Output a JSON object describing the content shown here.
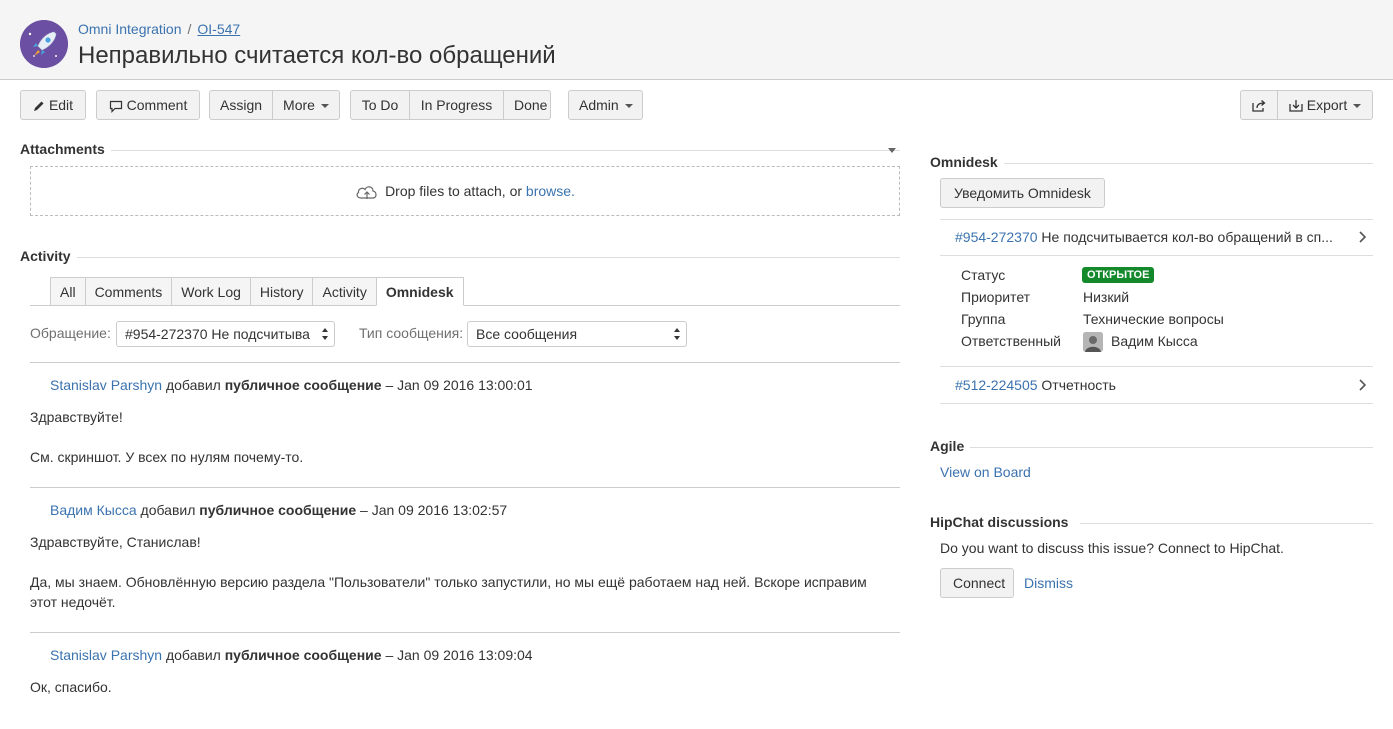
{
  "header": {
    "project": "Omni Integration",
    "separator": "/",
    "issue_key": "OI-547",
    "title": "Неправильно считается кол-во обращений"
  },
  "toolbar": {
    "edit": "Edit",
    "comment": "Comment",
    "assign": "Assign",
    "more": "More",
    "todo": "To Do",
    "in_progress": "In Progress",
    "done": "Done",
    "admin": "Admin",
    "export": "Export"
  },
  "attachments": {
    "heading": "Attachments",
    "drop_text": "Drop files to attach, or ",
    "browse": "browse."
  },
  "activity": {
    "heading": "Activity",
    "tabs": [
      "All",
      "Comments",
      "Work Log",
      "History",
      "Activity",
      "Omnidesk"
    ],
    "active_tab": "Omnidesk",
    "filter_label_1": "Обращение:",
    "filter_value_1": "#954-272370 Не подсчитыва",
    "filter_label_2": "Тип сообщения:",
    "filter_value_2": "Все сообщения",
    "comments": [
      {
        "author": "Stanislav Parshyn",
        "verb": "добавил",
        "type": "публичное сообщение",
        "dash": "–",
        "date": "Jan 09 2016 13:00:01",
        "lines": [
          "Здравствуйте!",
          "См. скриншот. У всех по нулям почему-то."
        ]
      },
      {
        "author": "Вадим Кысса",
        "verb": "добавил",
        "type": "публичное сообщение",
        "dash": "–",
        "date": "Jan 09 2016 13:02:57",
        "lines": [
          "Здравствуйте, Станислав!",
          "Да, мы знаем. Обновлённую версию раздела \"Пользователи\" только запустили, но мы ещё работаем над ней. Вскоре исправим",
          "этот недочёт."
        ]
      },
      {
        "author": "Stanislav Parshyn",
        "verb": "добавил",
        "type": "публичное сообщение",
        "dash": "–",
        "date": "Jan 09 2016 13:09:04",
        "lines": [
          "Ок, спасибо."
        ]
      }
    ]
  },
  "omnidesk": {
    "heading": "Omnidesk",
    "notify_button": "Уведомить Omnidesk",
    "ticket_1_id": "#954-272370",
    "ticket_1_title": "Не подсчитывается кол-во обращений в сп...",
    "status_label": "Статус",
    "status_value": "ОТКРЫТОЕ",
    "status_color": "#14892c",
    "priority_label": "Приоритет",
    "priority_value": "Низкий",
    "group_label": "Группа",
    "group_value": "Технические вопросы",
    "assignee_label": "Ответственный",
    "assignee_value": "Вадим Кысса",
    "ticket_2_id": "#512-224505",
    "ticket_2_title": "Отчетность"
  },
  "agile": {
    "heading": "Agile",
    "link": "View on Board"
  },
  "hipchat": {
    "heading": "HipChat discussions",
    "text": "Do you want to discuss this issue? Connect to HipChat.",
    "connect": "Connect",
    "dismiss": "Dismiss"
  },
  "colors": {
    "link": "#3b73af",
    "header_bg": "#f5f5f5",
    "avatar": "#6b4fa3"
  }
}
